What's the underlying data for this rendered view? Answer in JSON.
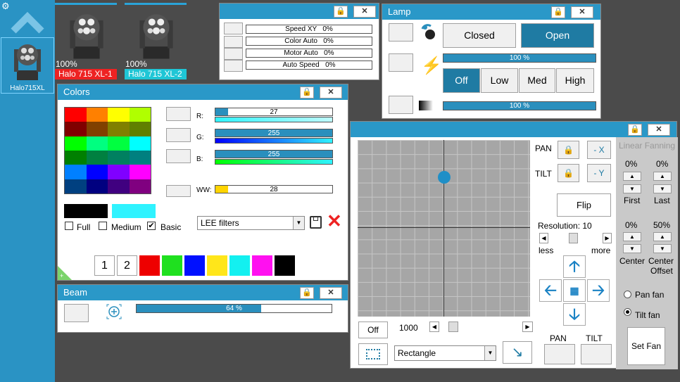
{
  "sidebar": {
    "fixture_label": "Halo715XL"
  },
  "fixtures": [
    {
      "percent": "100%",
      "name": "Halo 715 XL-1",
      "color": "#e22"
    },
    {
      "percent": "100%",
      "name": "Halo 715 XL-2",
      "color": "#1fc6d6"
    }
  ],
  "motion_panel": {
    "rows": [
      {
        "label": "Speed XY",
        "value": "0%"
      },
      {
        "label": "Color Auto",
        "value": "0%"
      },
      {
        "label": "Motor Auto",
        "value": "0%"
      },
      {
        "label": "Auto Speed",
        "value": "0%"
      }
    ]
  },
  "lamp": {
    "title": "Lamp",
    "closed": "Closed",
    "open": "Open",
    "power_percent": "100 %",
    "power_level": 1.0,
    "off": "Off",
    "low": "Low",
    "med": "Med",
    "high": "High",
    "dimmer_percent": "100 %",
    "dimmer_level": 1.0
  },
  "colors": {
    "title": "Colors",
    "r_label": "R:",
    "g_label": "G:",
    "b_label": "B:",
    "ww_label": "WW:",
    "r": "27",
    "g": "255",
    "b": "255",
    "ww": "28",
    "r_level": 0.11,
    "g_level": 1.0,
    "b_level": 1.0,
    "ww_level": 0.11,
    "full": "Full",
    "medium": "Medium",
    "basic": "Basic",
    "filter": "LEE filters",
    "preset_1": "1",
    "preset_2": "2"
  },
  "beam": {
    "title": "Beam",
    "percent": "64 %",
    "level": 0.64
  },
  "position": {
    "pan": "PAN",
    "tilt": "TILT",
    "minus_x": "- X",
    "minus_y": "- Y",
    "flip": "Flip",
    "resolution": "Resolution: 10",
    "less": "less",
    "more": "more",
    "off": "Off",
    "speed_value": "1000",
    "shape": "Rectangle",
    "pan_btn": "PAN",
    "tilt_btn": "TILT"
  },
  "fanning": {
    "title": "Linear Fanning",
    "first_pct": "0%",
    "last_pct": "0%",
    "first": "First",
    "last": "Last",
    "center_pct": "0%",
    "offset_pct": "50%",
    "center": "Center",
    "center_offset_1": "Center",
    "center_offset_2": "Offset",
    "pan_fan": "Pan fan",
    "tilt_fan": "Tilt fan",
    "set_fan": "Set Fan"
  }
}
